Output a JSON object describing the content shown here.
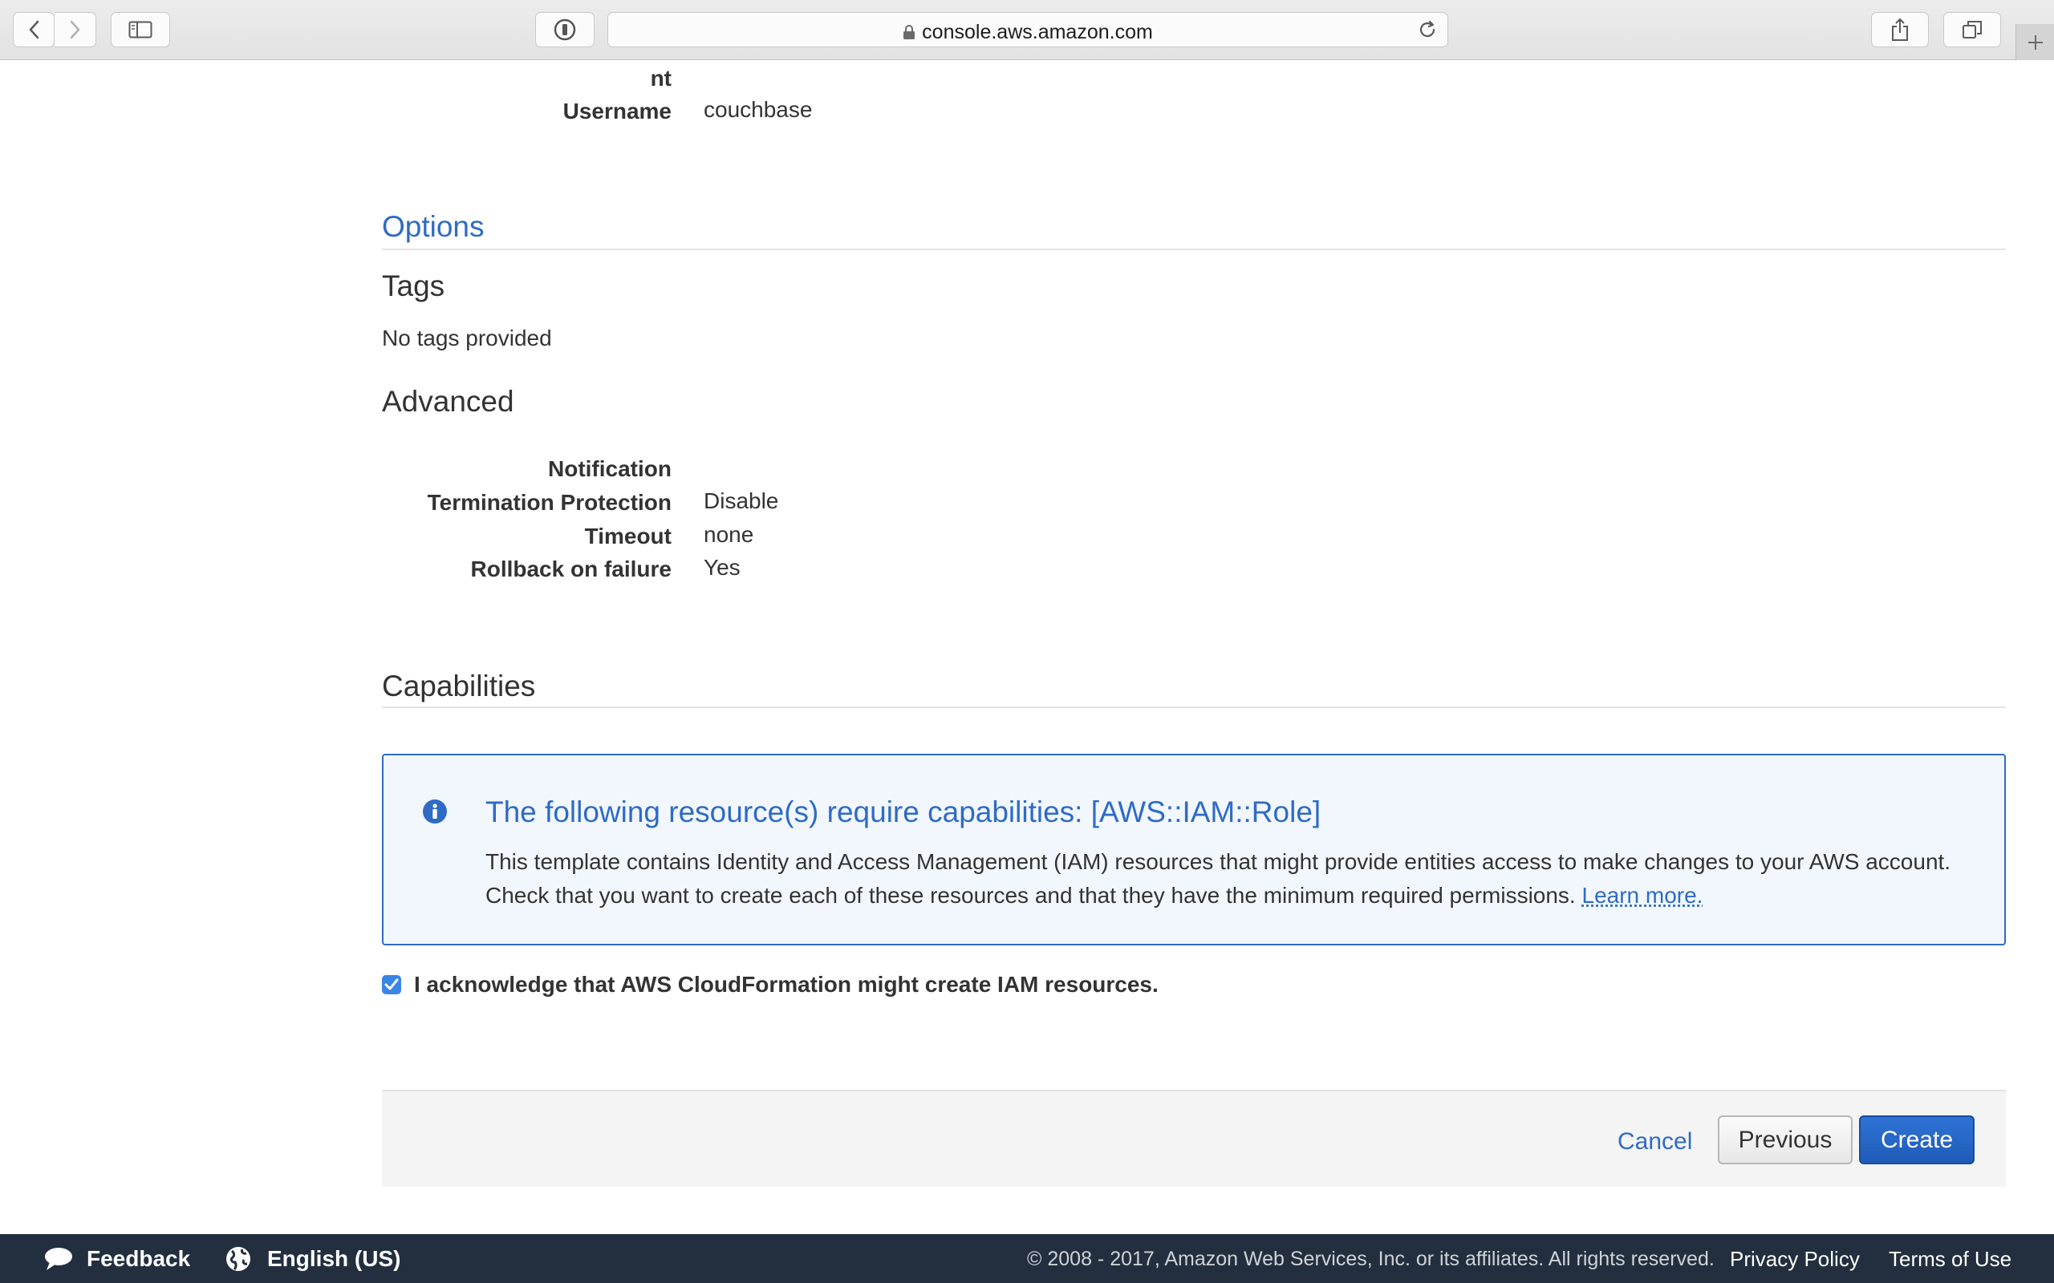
{
  "browser": {
    "url": "console.aws.amazon.com"
  },
  "parameters": {
    "truncated_label": "nt",
    "username_label": "Username",
    "username_value": "couchbase"
  },
  "options": {
    "section_title": "Options",
    "tags_heading": "Tags",
    "tags_value": "No tags provided",
    "advanced_heading": "Advanced",
    "rows": [
      {
        "label": "Notification",
        "value": ""
      },
      {
        "label": "Termination Protection",
        "value": "Disable"
      },
      {
        "label": "Timeout",
        "value": "none"
      },
      {
        "label": "Rollback on failure",
        "value": "Yes"
      }
    ]
  },
  "capabilities": {
    "heading": "Capabilities",
    "info_title": "The following resource(s) require capabilities: [AWS::IAM::Role]",
    "info_body": "This template contains Identity and Access Management (IAM) resources that might provide entities access to make changes to your AWS account. Check that you want to create each of these resources and that they have the minimum required permissions.",
    "learn_more": "Learn more.",
    "ack_label": "I acknowledge that AWS CloudFormation might create IAM resources.",
    "ack_checked": true
  },
  "actions": {
    "cancel": "Cancel",
    "previous": "Previous",
    "create": "Create"
  },
  "footer": {
    "feedback": "Feedback",
    "language": "English (US)",
    "copyright": "© 2008 - 2017, Amazon Web Services, Inc. or its affiliates. All rights reserved.",
    "privacy": "Privacy Policy",
    "terms": "Terms of Use"
  },
  "colors": {
    "link": "#2f6bc4",
    "primary_button": "#1f5bb7",
    "footer_bg": "#232f3e",
    "info_bg": "#f1f7fd"
  },
  "icons": [
    "back-icon",
    "forward-icon",
    "sidebar-icon",
    "privacy-report-icon",
    "lock-icon",
    "reload-icon",
    "share-icon",
    "tabs-icon",
    "plus-icon",
    "info-icon",
    "checkmark-icon",
    "speech-bubble-icon",
    "globe-icon"
  ]
}
